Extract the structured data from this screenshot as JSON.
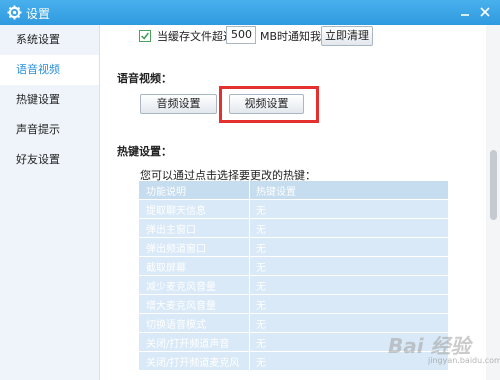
{
  "window": {
    "title": "设置"
  },
  "sidebar": {
    "items": [
      {
        "label": "系统设置"
      },
      {
        "label": "语音视频"
      },
      {
        "label": "热键设置"
      },
      {
        "label": "声音提示"
      },
      {
        "label": "好友设置"
      }
    ],
    "active_index": 1
  },
  "cache": {
    "checked": true,
    "label": "当缓存文件超过",
    "value": "500",
    "suffix": "MB时通知我",
    "clean_button": "立即清理"
  },
  "voice_video": {
    "title": "语音视频：",
    "audio_button": "音频设置",
    "video_button": "视频设置"
  },
  "hotkeys": {
    "title": "热键设置：",
    "hint": "您可以通过点击选择要更改的热键：",
    "columns": [
      "功能说明",
      "热键设置"
    ],
    "rows": [
      {
        "name": "提取聊天信息",
        "key": "无"
      },
      {
        "name": "弹出主窗口",
        "key": "无"
      },
      {
        "name": "弹出频道窗口",
        "key": "无"
      },
      {
        "name": "截取屏幕",
        "key": "无"
      },
      {
        "name": "减少麦克风音量",
        "key": "无"
      },
      {
        "name": "增大麦克风音量",
        "key": "无"
      },
      {
        "name": "切换语音模式",
        "key": "无"
      },
      {
        "name": "关闭/打开频道声音",
        "key": "无"
      },
      {
        "name": "关闭/打开频道麦克风",
        "key": "无"
      }
    ]
  },
  "watermark": {
    "text": "Bai 经验",
    "sub": "jingyan.baidu.com"
  },
  "colors": {
    "titlebar": "#2f9ae0",
    "accent": "#2a8fd6",
    "highlight": "#e53030",
    "table_row": "#d9e9f7"
  }
}
